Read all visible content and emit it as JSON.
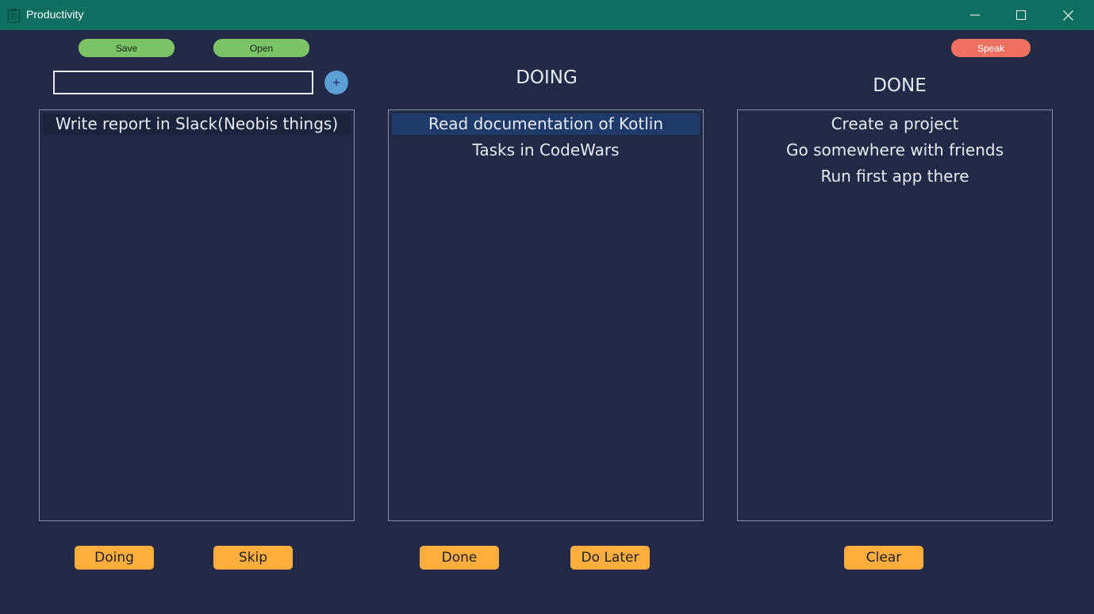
{
  "window": {
    "title": "Productivity"
  },
  "toolbar": {
    "save_label": "Save",
    "open_label": "Open",
    "speak_label": "Speak"
  },
  "input": {
    "value": "",
    "add_label": "+"
  },
  "columns": {
    "doing_heading": "DOING",
    "done_heading": "DONE"
  },
  "todo": {
    "items": [
      "Write report in Slack(Neobis things)"
    ]
  },
  "doing": {
    "items": [
      "Read documentation of Kotlin",
      "Tasks in CodeWars"
    ]
  },
  "done": {
    "items": [
      "Create a project",
      "Go somewhere with friends",
      "Run first app there"
    ]
  },
  "actions": {
    "doing_label": "Doing",
    "skip_label": "Skip",
    "done_label": "Done",
    "do_later_label": "Do Later",
    "clear_label": "Clear"
  },
  "colors": {
    "background": "#222a47",
    "titlebar": "#0e6f61",
    "green_button": "#7bc465",
    "speak_button": "#f07060",
    "action_button": "#ffad3d",
    "add_button": "#5a9fd6",
    "selected_blue": "#1e3b6b"
  },
  "icons": {
    "app": "clipboard-icon",
    "minimize": "minimize-icon",
    "maximize": "maximize-icon",
    "close": "close-icon"
  }
}
